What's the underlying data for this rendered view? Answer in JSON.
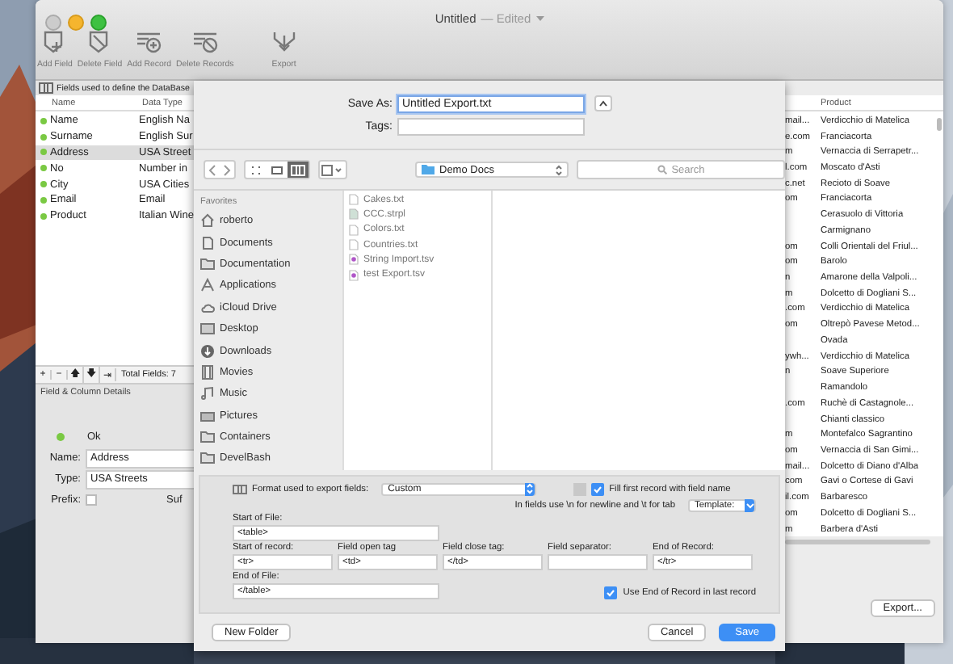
{
  "window": {
    "title": "Untitled",
    "status": "— Edited"
  },
  "toolbar": [
    {
      "label": "Add Field",
      "kind": "field-plus"
    },
    {
      "label": "Delete Field",
      "kind": "field-slash"
    },
    {
      "label": "Add Record",
      "kind": "record-plus"
    },
    {
      "label": "Delete Records",
      "kind": "record-slash"
    },
    {
      "label": "Export",
      "kind": "export"
    }
  ],
  "fields_panel": {
    "title": "Fields used to define the DataBase",
    "columns": [
      "Name",
      "Data Type"
    ],
    "rows": [
      {
        "name": "Name",
        "type": "English Na",
        "selected": false
      },
      {
        "name": "Surname",
        "type": "English Sur",
        "selected": false
      },
      {
        "name": "Address",
        "type": "USA Street",
        "selected": true
      },
      {
        "name": "No",
        "type": "Number in",
        "selected": false
      },
      {
        "name": "City",
        "type": "USA Cities",
        "selected": false
      },
      {
        "name": "Email",
        "type": "Email",
        "selected": false
      },
      {
        "name": "Product",
        "type": "Italian Wine",
        "selected": false
      }
    ],
    "buttons": [
      "+",
      "−",
      "🡅",
      "🡇",
      "⇥"
    ],
    "total": "Total Fields: 7"
  },
  "details": {
    "title": "Field & Column Details",
    "status": "Ok",
    "name_label": "Name:",
    "name_value": "Address",
    "type_label": "Type:",
    "type_value": "USA Streets",
    "prefix_label": "Prefix:",
    "prefix_checked": false,
    "suffix_label": "Suf"
  },
  "table": {
    "header": "Product",
    "rows": [
      {
        "column_1": "mail...",
        "product": "Verdicchio di Matelica"
      },
      {
        "column_1": "e.com",
        "product": "Franciacorta"
      },
      {
        "column_1": "m",
        "product": "Vernaccia di Serrapetr..."
      },
      {
        "column_1": "l.com",
        "product": "Moscato d'Asti"
      },
      {
        "column_1": "c.net",
        "product": "Recioto di Soave"
      },
      {
        "column_1": "om",
        "product": "Franciacorta"
      },
      {
        "product": "Cerasuolo di Vittoria"
      },
      {
        "product": "Carmignano"
      },
      {
        "column_1": "om",
        "product": "Colli Orientali del Friul..."
      },
      {
        "column_1": "om",
        "product": "Barolo"
      },
      {
        "column_1": "n",
        "product": "Amarone della Valpoli..."
      },
      {
        "column_1": "m",
        "product": "Dolcetto di Dogliani S..."
      },
      {
        "column_1": ".com",
        "product": "Verdicchio di Matelica"
      },
      {
        "column_1": "om",
        "product": "Oltrepò Pavese Metod..."
      },
      {
        "product": "Ovada"
      },
      {
        "column_1": "ywh...",
        "product": "Verdicchio di Matelica"
      },
      {
        "column_1": "n",
        "product": "Soave Superiore"
      },
      {
        "product": "Ramandolo"
      },
      {
        "column_1": ".com",
        "product": "Ruchè di Castagnole..."
      },
      {
        "product": "Chianti classico"
      },
      {
        "column_1": "m",
        "product": "Montefalco Sagrantino"
      },
      {
        "column_1": "om",
        "product": "Vernaccia di San Gimi..."
      },
      {
        "column_1": "mail...",
        "product": "Dolcetto di Diano d'Alba"
      },
      {
        "column_1": "com",
        "product": "Gavi o Cortese di Gavi"
      },
      {
        "column_1": "il.com",
        "product": "Barbaresco"
      },
      {
        "column_1": "om",
        "product": "Dolcetto di Dogliani S..."
      },
      {
        "column_1": "m",
        "product": "Barbera d'Asti"
      }
    ],
    "export_button": "Export..."
  },
  "save_dialog": {
    "save_as_label": "Save As:",
    "save_as_value": "Untitled Export.txt",
    "tags_label": "Tags:",
    "location": "Demo Docs",
    "search_placeholder": "Search",
    "view_modes": [
      {
        "kind": "icons",
        "selected": false
      },
      {
        "kind": "list",
        "selected": false
      },
      {
        "kind": "columns",
        "selected": true
      }
    ],
    "sidebar_title": "Favorites",
    "sidebar": [
      {
        "label": "roberto",
        "kind": "home"
      },
      {
        "label": "Documents",
        "kind": "documents"
      },
      {
        "label": "Documentation",
        "kind": "folder"
      },
      {
        "label": "Applications",
        "kind": "applications"
      },
      {
        "label": "iCloud Drive",
        "kind": "cloud"
      },
      {
        "label": "Desktop",
        "kind": "desktop"
      },
      {
        "label": "Downloads",
        "kind": "downloads"
      },
      {
        "label": "Movies",
        "kind": "movies"
      },
      {
        "label": "Music",
        "kind": "music"
      },
      {
        "label": "Pictures",
        "kind": "pictures"
      },
      {
        "label": "Containers",
        "kind": "folder"
      },
      {
        "label": "DevelBash",
        "kind": "folder"
      }
    ],
    "files": [
      {
        "name": "Cakes.txt",
        "kind": "text"
      },
      {
        "name": "CCC.strpl",
        "kind": "app"
      },
      {
        "name": "Colors.txt",
        "kind": "text"
      },
      {
        "name": "Countries.txt",
        "kind": "text"
      },
      {
        "name": "String Import.tsv",
        "kind": "tsv"
      },
      {
        "name": "test Export.tsv",
        "kind": "tsv"
      }
    ],
    "options": {
      "format_label": "Format used to export fields:",
      "format_value": "Custom",
      "second_checkbox_disabled": true,
      "fill_first_checked": true,
      "fill_first_label": "Fill first record with field name",
      "hint": "In fields use \\n for newline and \\t for tab",
      "template": "Template:",
      "start_file_label": "Start of File:",
      "start_file_value": "<table>",
      "tags": [
        {
          "label": "Start of record:",
          "value": "<tr>"
        },
        {
          "label": "Field open tag",
          "value": "<td>"
        },
        {
          "label": "Field close tag:",
          "value": "</td>"
        },
        {
          "label": "Field separator:"
        },
        {
          "label": "End of Record:",
          "value": "</tr>"
        }
      ],
      "end_file_label": "End of File:",
      "end_file_value": "</table>",
      "use_end_checked": true,
      "use_end_label": "Use End of Record in last record"
    },
    "buttons": {
      "new_folder": "New Folder",
      "cancel": "Cancel",
      "save": "Save"
    }
  }
}
